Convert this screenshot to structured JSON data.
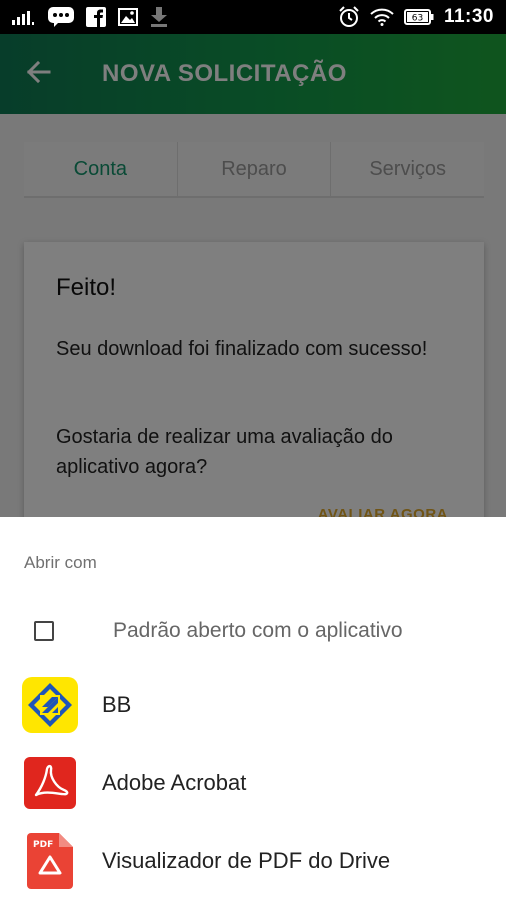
{
  "status_bar": {
    "time": "11:30",
    "battery": "63",
    "left_icons": [
      "signal-icon",
      "messenger-icon",
      "facebook-icon",
      "gallery-icon",
      "download-icon"
    ],
    "right_icons": [
      "alarm-icon",
      "wifi-icon",
      "battery-icon"
    ]
  },
  "app_bar": {
    "title": "NOVA SOLICITAÇÃO",
    "back_icon": "arrow-back-icon",
    "colors": {
      "start": "#0f7a54",
      "end": "#1faa3c"
    }
  },
  "tabs": [
    {
      "label": "Conta",
      "active": true
    },
    {
      "label": "Reparo",
      "active": false
    },
    {
      "label": "Serviços",
      "active": false
    }
  ],
  "dialog": {
    "title": "Feito!",
    "message1": "Seu download foi finalizado com sucesso!",
    "message2": "Gostaria de realizar uma avaliação do aplicativo agora?",
    "action": "AVALIAR AGORA"
  },
  "sheet": {
    "title": "Abrir com",
    "default_option": "Padrão aberto com o aplicativo",
    "apps": [
      {
        "name": "BB",
        "icon": "banco-do-brasil-icon"
      },
      {
        "name": "Adobe Acrobat",
        "icon": "adobe-acrobat-icon"
      },
      {
        "name": "Visualizador de PDF do Drive",
        "icon": "drive-pdf-viewer-icon"
      }
    ],
    "pdf_badge": "PDF"
  },
  "colors": {
    "accent": "#14946c",
    "action": "#e1a92a",
    "bb_yellow": "#ffe600",
    "bb_blue": "#1f55b8",
    "acrobat_red": "#e0261e",
    "drive_red": "#ea4335"
  }
}
